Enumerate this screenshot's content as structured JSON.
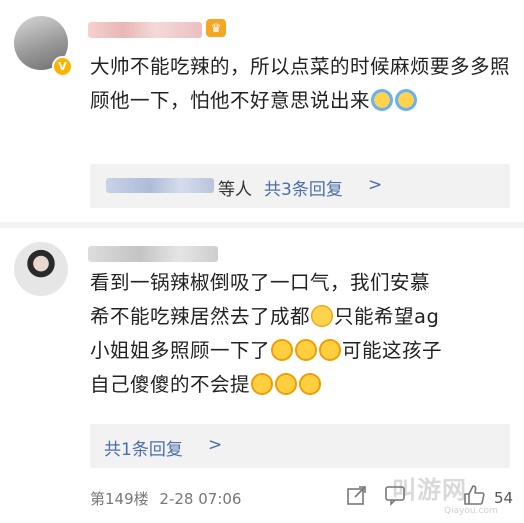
{
  "comment1": {
    "text": "大帅不能吃辣的，所以点菜的时候麻烦要多多照顾他一下，怕他不好意思说出来",
    "replies": {
      "suffix": "等人",
      "count_text": "共3条回复",
      "chevron": ">"
    },
    "vip_icon": "crown-icon",
    "verified_icon": "v-badge-icon"
  },
  "comment2": {
    "text_line1": "看到一锅辣椒倒吸了一口气，我们安慕",
    "text_line2": "希不能吃辣居然去了成都",
    "text_line2b": "只能希望ag",
    "text_line3": "小姐姐多照顾一下了",
    "text_line3b": "可能这孩子",
    "text_line4": "自己傻傻的不会提",
    "replies": {
      "count_text": "共1条回复",
      "chevron": ">"
    },
    "floor": "第149楼",
    "time": "2-28 07:06",
    "like_count": "54",
    "icons": [
      "share-icon",
      "comment-icon",
      "like-icon"
    ]
  },
  "watermark": {
    "text": "叫游网",
    "sub": "Qiayou.com"
  },
  "colors": {
    "link": "#4a6ea9",
    "divider": "#f2f2f2",
    "reply_bg": "#f2f2f2"
  }
}
